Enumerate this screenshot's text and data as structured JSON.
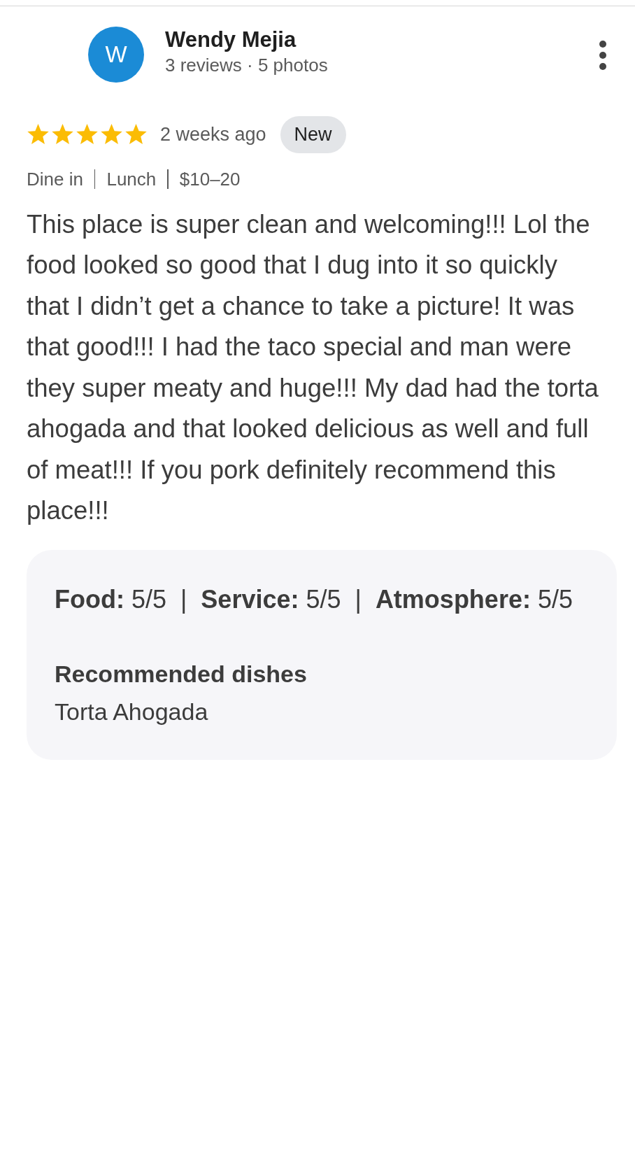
{
  "reviewer": {
    "initial": "W",
    "name": "Wendy Mejia",
    "meta": "3 reviews · 5 photos"
  },
  "review": {
    "stars": 5,
    "time": "2 weeks ago",
    "badge": "New",
    "tags": [
      "Dine in",
      "Lunch",
      "$10–20"
    ],
    "text": "This place is super clean and welcoming!!! Lol the food looked so good that I dug into it so quickly that I didn’t get a chance to take a picture! It was that good!!! I had the taco special and man were they super meaty and huge!!! My dad had the torta ahogada and that looked delicious as well and full of meat!!! If you pork definitely recommend this place!!!",
    "ratings": "**Food:** 5/5  |  **Service:** 5/5  |  **Atmosphere:** 5/5",
    "dishes_title": "Recommended dishes",
    "dishes": "Torta Ahogada"
  }
}
